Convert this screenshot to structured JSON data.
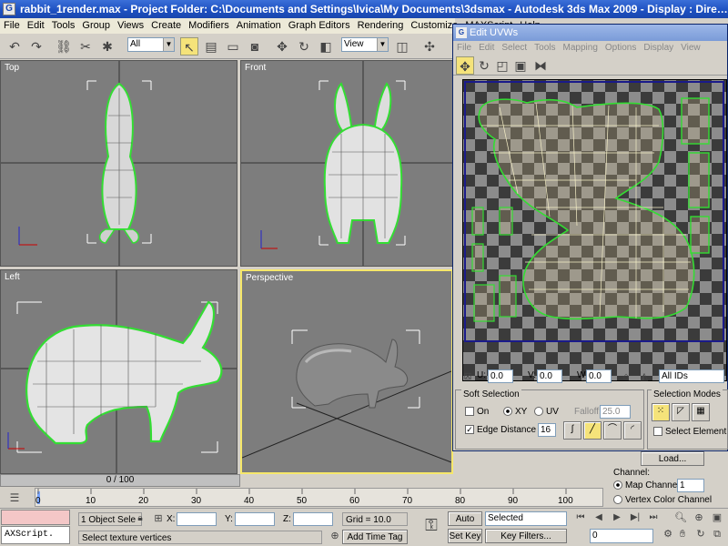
{
  "window": {
    "title": "rabbit_1render.max   - Project Folder: C:\\Documents and Settings\\Ivica\\My Documents\\3dsmax    - Autodesk 3ds Max  2009     - Display : Dire…",
    "app_icon": "G"
  },
  "menu": [
    "File",
    "Edit",
    "Tools",
    "Group",
    "Views",
    "Create",
    "Modifiers",
    "Animation",
    "Graph Editors",
    "Rendering",
    "Customize",
    "MAXScript",
    "Help"
  ],
  "toolbar": {
    "filter_value": "All",
    "ref_coord_value": "View",
    "icons": [
      "undo-icon",
      "redo-icon",
      "link-icon",
      "unlink-icon",
      "bind-icon",
      "select-icon",
      "select-name-icon",
      "region-icon",
      "window-icon",
      "move-icon",
      "rotate-icon",
      "scale-icon"
    ]
  },
  "viewports": {
    "top": "Top",
    "front": "Front",
    "left": "Left",
    "perspective": "Perspective"
  },
  "uv_editor": {
    "title": "Edit UVWs",
    "menu": [
      "File",
      "Edit",
      "Select",
      "Tools",
      "Mapping",
      "Options",
      "Display",
      "View"
    ],
    "u_label": "U:",
    "u_value": "0.0",
    "v_label": "V:",
    "v_value": "0.0",
    "w_label": "W:",
    "w_value": "0.0",
    "ids_value": "All IDs"
  },
  "soft_selection": {
    "title": "Soft Selection",
    "on_label": "On",
    "xy_label": "XY",
    "uv_label": "UV",
    "falloff_label": "Falloff:",
    "falloff_value": "25.0",
    "edge_distance_label": "Edge Distance",
    "edge_distance_value": "16"
  },
  "selection_modes": {
    "title": "Selection Modes",
    "select_element_label": "Select Element"
  },
  "channel": {
    "load_label": "Load...",
    "channel_label": "Channel:",
    "map_channel_label": "Map Channel:",
    "map_channel_value": "1",
    "vertex_color_label": "Vertex Color Channel"
  },
  "timeline": {
    "slider_label": "0 / 100",
    "ticks": [
      "0",
      "10",
      "20",
      "30",
      "40",
      "50",
      "60",
      "70",
      "80",
      "90",
      "100"
    ]
  },
  "status": {
    "maxscript_label": "AXScript.",
    "objects_selected": "1 Object Sele",
    "prompt": "Select texture vertices",
    "x_label": "X:",
    "y_label": "Y:",
    "z_label": "Z:",
    "grid": "Grid = 10.0",
    "add_time_tag": "Add Time Tag",
    "auto_key": "Auto Key",
    "set_key": "Set Key",
    "selected_value": "Selected",
    "key_filters": "Key Filters...",
    "frame_value": "0"
  }
}
